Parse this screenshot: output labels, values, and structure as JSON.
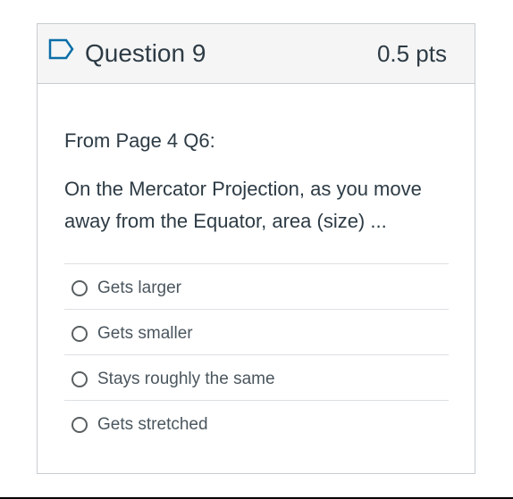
{
  "question": {
    "title": "Question 9",
    "points": "0.5 pts",
    "flag_icon": "flag-outline-icon",
    "reference": "From Page 4 Q6:",
    "prompt": "On the Mercator Projection, as you move away from the Equator, area (size) ...",
    "answers": [
      {
        "label": "Gets larger",
        "selected": false
      },
      {
        "label": "Gets smaller",
        "selected": false
      },
      {
        "label": "Stays roughly the same",
        "selected": false
      },
      {
        "label": "Gets stretched",
        "selected": false
      }
    ]
  },
  "colors": {
    "text": "#2d3b45",
    "header_bg": "#f5f5f5",
    "border": "#c7cdd1",
    "flag": "#0b6ea8"
  }
}
